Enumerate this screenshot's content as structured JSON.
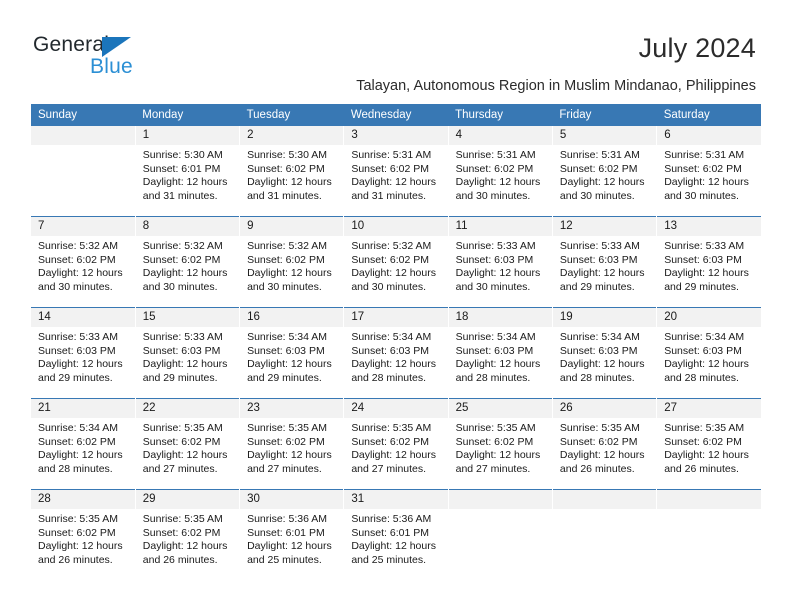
{
  "brand": {
    "name_part1": "General",
    "name_part2": "Blue",
    "accent_color": "#1b75bb",
    "secondary_color": "#2b8fd4",
    "triangle_icon": "triangle-icon"
  },
  "header": {
    "title": "July 2024",
    "subtitle": "Talayan, Autonomous Region in Muslim Mindanao, Philippines"
  },
  "calendar": {
    "header_bg": "#3878b4",
    "daynum_bg": "#f2f2f2",
    "weekday_headers": [
      "Sunday",
      "Monday",
      "Tuesday",
      "Wednesday",
      "Thursday",
      "Friday",
      "Saturday"
    ],
    "weeks": [
      [
        {
          "day": "",
          "sunrise": "",
          "sunset": "",
          "daylight_line1": "",
          "daylight_line2": "",
          "blank": true
        },
        {
          "day": "1",
          "sunrise": "Sunrise: 5:30 AM",
          "sunset": "Sunset: 6:01 PM",
          "daylight_line1": "Daylight: 12 hours",
          "daylight_line2": "and 31 minutes."
        },
        {
          "day": "2",
          "sunrise": "Sunrise: 5:30 AM",
          "sunset": "Sunset: 6:02 PM",
          "daylight_line1": "Daylight: 12 hours",
          "daylight_line2": "and 31 minutes."
        },
        {
          "day": "3",
          "sunrise": "Sunrise: 5:31 AM",
          "sunset": "Sunset: 6:02 PM",
          "daylight_line1": "Daylight: 12 hours",
          "daylight_line2": "and 31 minutes."
        },
        {
          "day": "4",
          "sunrise": "Sunrise: 5:31 AM",
          "sunset": "Sunset: 6:02 PM",
          "daylight_line1": "Daylight: 12 hours",
          "daylight_line2": "and 30 minutes."
        },
        {
          "day": "5",
          "sunrise": "Sunrise: 5:31 AM",
          "sunset": "Sunset: 6:02 PM",
          "daylight_line1": "Daylight: 12 hours",
          "daylight_line2": "and 30 minutes."
        },
        {
          "day": "6",
          "sunrise": "Sunrise: 5:31 AM",
          "sunset": "Sunset: 6:02 PM",
          "daylight_line1": "Daylight: 12 hours",
          "daylight_line2": "and 30 minutes."
        }
      ],
      [
        {
          "day": "7",
          "sunrise": "Sunrise: 5:32 AM",
          "sunset": "Sunset: 6:02 PM",
          "daylight_line1": "Daylight: 12 hours",
          "daylight_line2": "and 30 minutes."
        },
        {
          "day": "8",
          "sunrise": "Sunrise: 5:32 AM",
          "sunset": "Sunset: 6:02 PM",
          "daylight_line1": "Daylight: 12 hours",
          "daylight_line2": "and 30 minutes."
        },
        {
          "day": "9",
          "sunrise": "Sunrise: 5:32 AM",
          "sunset": "Sunset: 6:02 PM",
          "daylight_line1": "Daylight: 12 hours",
          "daylight_line2": "and 30 minutes."
        },
        {
          "day": "10",
          "sunrise": "Sunrise: 5:32 AM",
          "sunset": "Sunset: 6:02 PM",
          "daylight_line1": "Daylight: 12 hours",
          "daylight_line2": "and 30 minutes."
        },
        {
          "day": "11",
          "sunrise": "Sunrise: 5:33 AM",
          "sunset": "Sunset: 6:03 PM",
          "daylight_line1": "Daylight: 12 hours",
          "daylight_line2": "and 30 minutes."
        },
        {
          "day": "12",
          "sunrise": "Sunrise: 5:33 AM",
          "sunset": "Sunset: 6:03 PM",
          "daylight_line1": "Daylight: 12 hours",
          "daylight_line2": "and 29 minutes."
        },
        {
          "day": "13",
          "sunrise": "Sunrise: 5:33 AM",
          "sunset": "Sunset: 6:03 PM",
          "daylight_line1": "Daylight: 12 hours",
          "daylight_line2": "and 29 minutes."
        }
      ],
      [
        {
          "day": "14",
          "sunrise": "Sunrise: 5:33 AM",
          "sunset": "Sunset: 6:03 PM",
          "daylight_line1": "Daylight: 12 hours",
          "daylight_line2": "and 29 minutes."
        },
        {
          "day": "15",
          "sunrise": "Sunrise: 5:33 AM",
          "sunset": "Sunset: 6:03 PM",
          "daylight_line1": "Daylight: 12 hours",
          "daylight_line2": "and 29 minutes."
        },
        {
          "day": "16",
          "sunrise": "Sunrise: 5:34 AM",
          "sunset": "Sunset: 6:03 PM",
          "daylight_line1": "Daylight: 12 hours",
          "daylight_line2": "and 29 minutes."
        },
        {
          "day": "17",
          "sunrise": "Sunrise: 5:34 AM",
          "sunset": "Sunset: 6:03 PM",
          "daylight_line1": "Daylight: 12 hours",
          "daylight_line2": "and 28 minutes."
        },
        {
          "day": "18",
          "sunrise": "Sunrise: 5:34 AM",
          "sunset": "Sunset: 6:03 PM",
          "daylight_line1": "Daylight: 12 hours",
          "daylight_line2": "and 28 minutes."
        },
        {
          "day": "19",
          "sunrise": "Sunrise: 5:34 AM",
          "sunset": "Sunset: 6:03 PM",
          "daylight_line1": "Daylight: 12 hours",
          "daylight_line2": "and 28 minutes."
        },
        {
          "day": "20",
          "sunrise": "Sunrise: 5:34 AM",
          "sunset": "Sunset: 6:03 PM",
          "daylight_line1": "Daylight: 12 hours",
          "daylight_line2": "and 28 minutes."
        }
      ],
      [
        {
          "day": "21",
          "sunrise": "Sunrise: 5:34 AM",
          "sunset": "Sunset: 6:02 PM",
          "daylight_line1": "Daylight: 12 hours",
          "daylight_line2": "and 28 minutes."
        },
        {
          "day": "22",
          "sunrise": "Sunrise: 5:35 AM",
          "sunset": "Sunset: 6:02 PM",
          "daylight_line1": "Daylight: 12 hours",
          "daylight_line2": "and 27 minutes."
        },
        {
          "day": "23",
          "sunrise": "Sunrise: 5:35 AM",
          "sunset": "Sunset: 6:02 PM",
          "daylight_line1": "Daylight: 12 hours",
          "daylight_line2": "and 27 minutes."
        },
        {
          "day": "24",
          "sunrise": "Sunrise: 5:35 AM",
          "sunset": "Sunset: 6:02 PM",
          "daylight_line1": "Daylight: 12 hours",
          "daylight_line2": "and 27 minutes."
        },
        {
          "day": "25",
          "sunrise": "Sunrise: 5:35 AM",
          "sunset": "Sunset: 6:02 PM",
          "daylight_line1": "Daylight: 12 hours",
          "daylight_line2": "and 27 minutes."
        },
        {
          "day": "26",
          "sunrise": "Sunrise: 5:35 AM",
          "sunset": "Sunset: 6:02 PM",
          "daylight_line1": "Daylight: 12 hours",
          "daylight_line2": "and 26 minutes."
        },
        {
          "day": "27",
          "sunrise": "Sunrise: 5:35 AM",
          "sunset": "Sunset: 6:02 PM",
          "daylight_line1": "Daylight: 12 hours",
          "daylight_line2": "and 26 minutes."
        }
      ],
      [
        {
          "day": "28",
          "sunrise": "Sunrise: 5:35 AM",
          "sunset": "Sunset: 6:02 PM",
          "daylight_line1": "Daylight: 12 hours",
          "daylight_line2": "and 26 minutes."
        },
        {
          "day": "29",
          "sunrise": "Sunrise: 5:35 AM",
          "sunset": "Sunset: 6:02 PM",
          "daylight_line1": "Daylight: 12 hours",
          "daylight_line2": "and 26 minutes."
        },
        {
          "day": "30",
          "sunrise": "Sunrise: 5:36 AM",
          "sunset": "Sunset: 6:01 PM",
          "daylight_line1": "Daylight: 12 hours",
          "daylight_line2": "and 25 minutes."
        },
        {
          "day": "31",
          "sunrise": "Sunrise: 5:36 AM",
          "sunset": "Sunset: 6:01 PM",
          "daylight_line1": "Daylight: 12 hours",
          "daylight_line2": "and 25 minutes."
        },
        {
          "day": "",
          "sunrise": "",
          "sunset": "",
          "daylight_line1": "",
          "daylight_line2": "",
          "blank": true
        },
        {
          "day": "",
          "sunrise": "",
          "sunset": "",
          "daylight_line1": "",
          "daylight_line2": "",
          "blank": true
        },
        {
          "day": "",
          "sunrise": "",
          "sunset": "",
          "daylight_line1": "",
          "daylight_line2": "",
          "blank": true
        }
      ]
    ]
  }
}
